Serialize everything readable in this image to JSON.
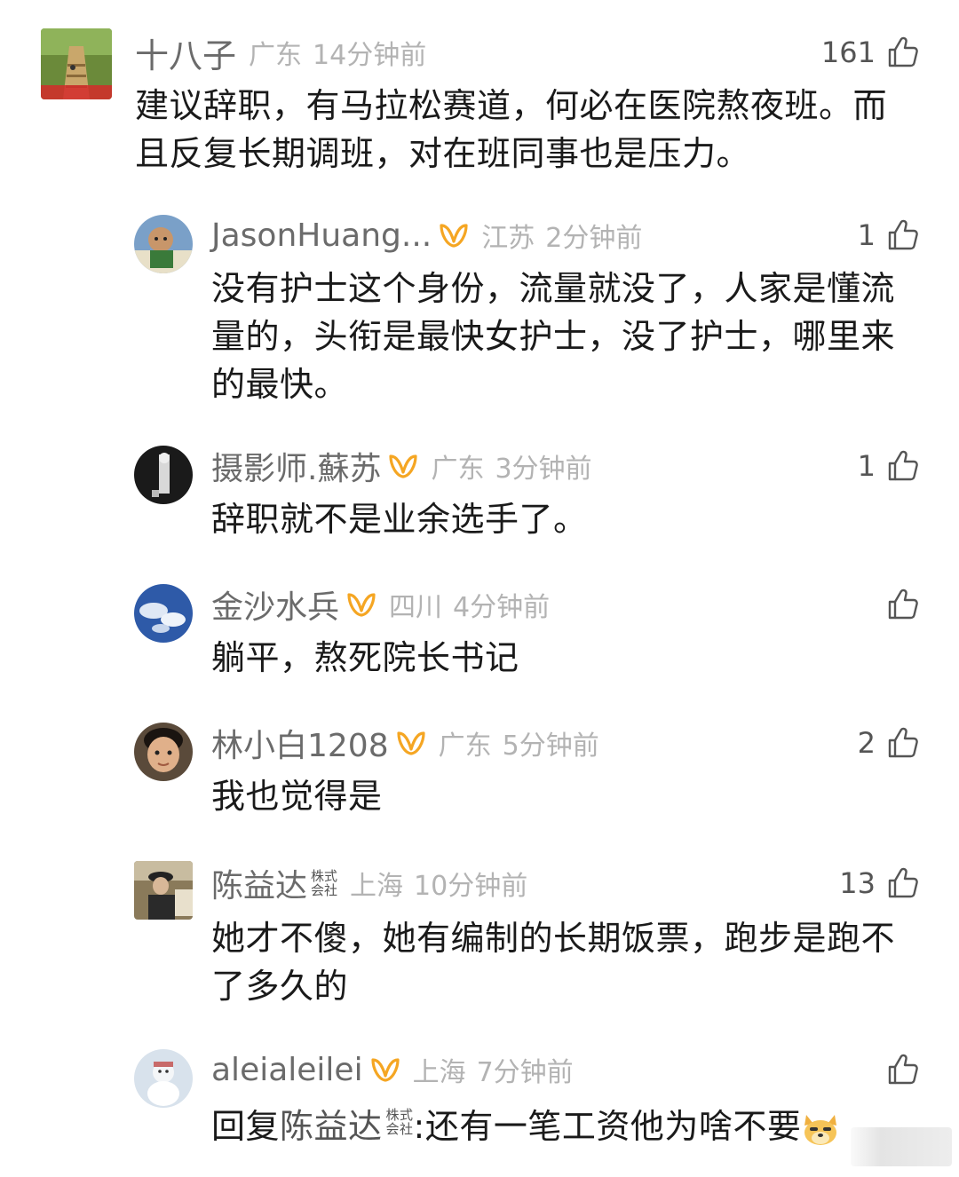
{
  "colors": {
    "text": "#1a1a1a",
    "username": "#6b6b6b",
    "meta": "#b3b3b3",
    "vip_badge": "#f5a623"
  },
  "comments": [
    {
      "name": "十八子",
      "location": "广东",
      "time": "14分钟前",
      "likes": "161",
      "vip": false,
      "avatar_icon": "avatar-photo-stairs",
      "text_lines": [
        "建议辞职，有马拉松赛道，何必在医院熬夜班。而",
        "且反复长期调班，对在班同事也是压力。"
      ]
    },
    {
      "name": "JasonHuang...",
      "location": "江苏",
      "time": "2分钟前",
      "likes": "1",
      "vip": true,
      "avatar_icon": "avatar-photo-child",
      "text_lines": [
        "没有护士这个身份，流量就没了，人家是懂流",
        "量的，头衔是最快女护士，没了护士，哪里来",
        "的最快。"
      ]
    },
    {
      "name": "摄影师.蘇苏",
      "location": "广东",
      "time": "3分钟前",
      "likes": "1",
      "vip": true,
      "avatar_icon": "avatar-photo-bw",
      "text_lines": [
        "辞职就不是业余选手了。"
      ]
    },
    {
      "name": "金沙水兵",
      "location": "四川",
      "time": "4分钟前",
      "likes": "",
      "vip": true,
      "avatar_icon": "avatar-photo-sky",
      "text_lines": [
        "躺平，熬死院长书记"
      ]
    },
    {
      "name": "林小白1208",
      "location": "广东",
      "time": "5分钟前",
      "likes": "2",
      "vip": true,
      "avatar_icon": "avatar-photo-kid",
      "text_lines": [
        "我也觉得是"
      ]
    },
    {
      "name": "陈益达",
      "company_badge": [
        "株式",
        "会社"
      ],
      "location": "上海",
      "time": "10分钟前",
      "likes": "13",
      "vip": false,
      "avatar_icon": "avatar-photo-painting",
      "text_lines": [
        "她才不傻，她有编制的长期饭票，跑步是跑不",
        "了多久的"
      ]
    },
    {
      "name": "aleialeilei",
      "location": "上海",
      "time": "7分钟前",
      "likes": "",
      "vip": true,
      "avatar_icon": "avatar-photo-snow",
      "reply_prefix": "回复",
      "reply_to": "陈益达",
      "reply_badge": [
        "株式",
        "会社"
      ],
      "reply_text": ":还有一笔工资他为啥不要",
      "emoji_icon": "doge-emoji-icon"
    }
  ]
}
